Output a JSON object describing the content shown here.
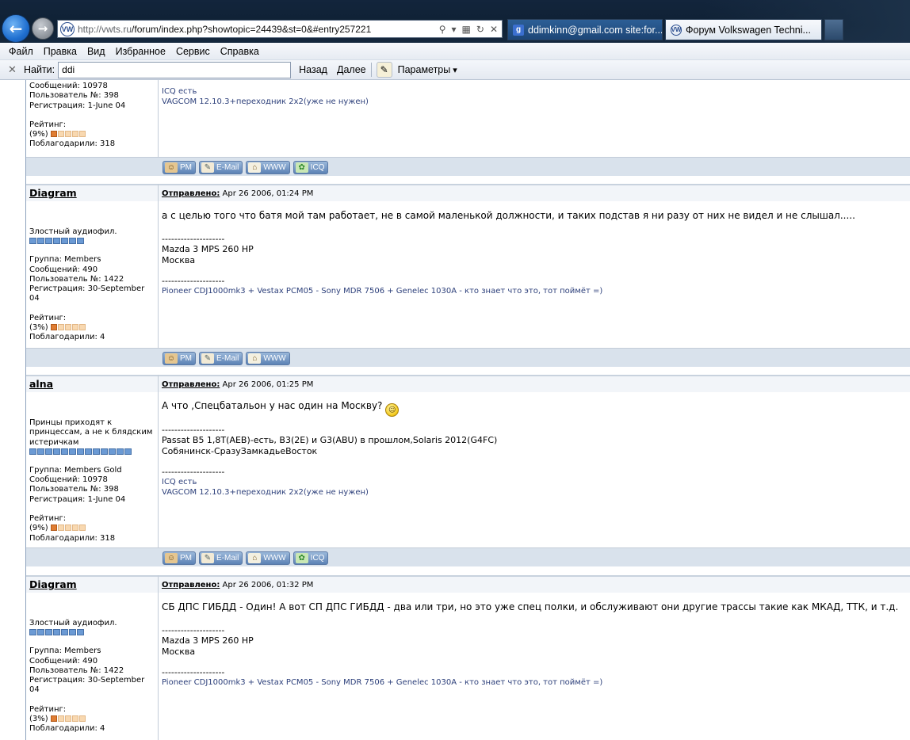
{
  "browser": {
    "address_host": "http://vwts.ru",
    "address_path": "/forum/index.php?showtopic=24439&st=0&#entry257221",
    "tabs": [
      {
        "label": "ddimkinn@gmail.com site:for..."
      },
      {
        "label": "Форум Volkswagen Techni..."
      }
    ]
  },
  "menu": [
    "Файл",
    "Правка",
    "Вид",
    "Избранное",
    "Сервис",
    "Справка"
  ],
  "find": {
    "close": "✕",
    "label": "Найти:",
    "value": "ddi",
    "prev": "Назад",
    "next": "Далее",
    "params": "Параметры"
  },
  "top_fragment": {
    "profile": [
      "Сообщений: 10978",
      "Пользователь №: 398",
      "Регистрация: 1-June 04"
    ],
    "rating_label": "Рейтинг:",
    "rating_pct": "(9%)",
    "rating_filled": 1,
    "thanks": "Поблагодарили: 318",
    "sig_lines": [
      "ICQ есть",
      "VAGCOM 12.10.3+переходник 2x2(уже не нужен)"
    ],
    "buttons": [
      "PM",
      "E-Mail",
      "WWW",
      "ICQ"
    ]
  },
  "posts": [
    {
      "author": "Diagram",
      "sent_label": "Отправлено:",
      "date": "Apr 26 2006, 01:24 PM",
      "title": "Злостный аудиофил.",
      "pips": 7,
      "profile": [
        "Группа: Members",
        "Сообщений: 490",
        "Пользователь №: 1422",
        "Регистрация: 30-September",
        "04"
      ],
      "rating_label": "Рейтинг:",
      "rating_pct": "(3%)",
      "rating_filled": 1,
      "thanks": "Поблагодарили: 4",
      "message": "а с целью того что батя мой там работает, не в самой маленькой должности, и таких подстав я ни разу от них не видел и не слышал.....",
      "sig_sep": "--------------------",
      "sig_a": [
        "Mazda 3 MPS 260 HP",
        "Москва"
      ],
      "sig_b": [
        "Pioneer CDJ1000mk3 + Vestax PCM05 - Sony MDR 7506 + Genelec 1030A - кто знает что это, тот поймёт =)"
      ],
      "buttons": [
        "PM",
        "E-Mail",
        "WWW"
      ]
    },
    {
      "author": "alna",
      "sent_label": "Отправлено:",
      "date": "Apr 26 2006, 01:25 PM",
      "title": "Принцы приходят к принцессам, а не к блядским истеричкам",
      "pips": 13,
      "profile": [
        "Группа: Members Gold",
        "Сообщений: 10978",
        "Пользователь №: 398",
        "Регистрация: 1-June 04"
      ],
      "rating_label": "Рейтинг:",
      "rating_pct": "(9%)",
      "rating_filled": 1,
      "thanks": "Поблагодарили: 318",
      "message": "А что ,Спецбатальон у нас один на Москву?",
      "smiley": true,
      "sig_sep": "--------------------",
      "sig_a": [
        "Passat B5 1,8T(AEB)-есть, B3(2E) и G3(ABU) в прошлом,Solaris 2012(G4FC)",
        "Собянинск-СразуЗамкадьеВосток"
      ],
      "sig_b": [
        "ICQ есть",
        "VAGCOM 12.10.3+переходник 2x2(уже не нужен)"
      ],
      "buttons": [
        "PM",
        "E-Mail",
        "WWW",
        "ICQ"
      ]
    },
    {
      "author": "Diagram",
      "sent_label": "Отправлено:",
      "date": "Apr 26 2006, 01:32 PM",
      "title": "Злостный аудиофил.",
      "pips": 7,
      "profile": [
        "Группа: Members",
        "Сообщений: 490",
        "Пользователь №: 1422",
        "Регистрация: 30-September",
        "04"
      ],
      "rating_label": "Рейтинг:",
      "rating_pct": "(3%)",
      "rating_filled": 1,
      "thanks": "Поблагодарили: 4",
      "message": "СБ ДПС ГИБДД - Один! А вот СП ДПС ГИБДД - два или три, но это уже спец полки, и обслуживают они другие трассы такие как МКАД, ТТК, и т.д.",
      "sig_sep": "--------------------",
      "sig_a": [
        "Mazda 3 MPS 260 HP",
        "Москва"
      ],
      "sig_b": [
        "Pioneer CDJ1000mk3 + Vestax PCM05 - Sony MDR 7506 + Genelec 1030A - кто знает что это, тот поймёт =)"
      ],
      "buttons": []
    }
  ]
}
